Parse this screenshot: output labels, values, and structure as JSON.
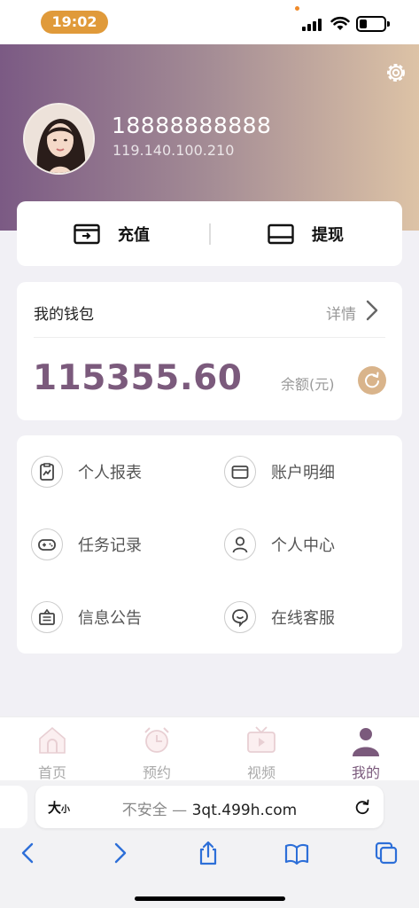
{
  "status_bar": {
    "time": "19:02"
  },
  "profile": {
    "phone": "18888888888",
    "ip": "119.140.100.210"
  },
  "actions": {
    "recharge_label": "充值",
    "withdraw_label": "提现"
  },
  "wallet": {
    "title": "我的钱包",
    "detail_label": "详情",
    "balance": "115355.60",
    "balance_label": "余额(元)"
  },
  "menu": {
    "personal_report": "个人报表",
    "account_detail": "账户明细",
    "task_record": "任务记录",
    "personal_center": "个人中心",
    "info_notice": "信息公告",
    "online_service": "在线客服"
  },
  "tabbar": {
    "home": "首页",
    "reserve": "预约",
    "video": "视频",
    "mine": "我的"
  },
  "browser": {
    "text_size": "大",
    "text_size_small": "小",
    "security_label": "不安全 —",
    "url": "3qt.499h.com"
  },
  "colors": {
    "accent": "#7b5a7c",
    "gold": "#d9b48b",
    "header_start": "#7b5a84",
    "header_end": "#ddc3a6"
  }
}
